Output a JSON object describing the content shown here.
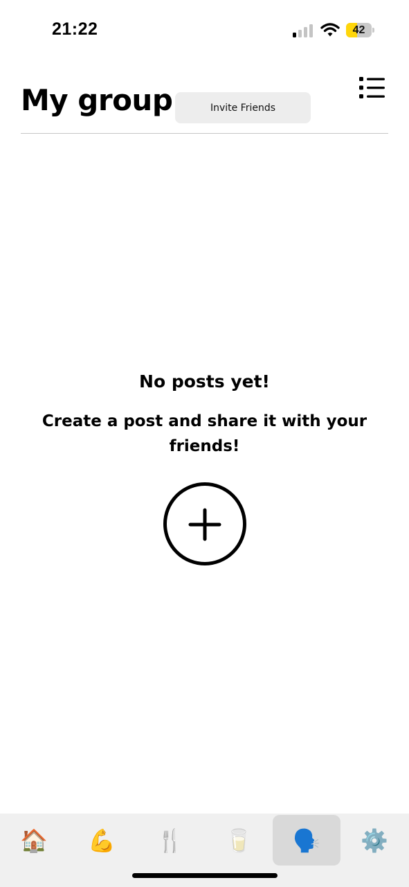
{
  "status_bar": {
    "time": "21:22",
    "battery_level": "42",
    "battery_fraction": 0.42,
    "signal_bars_active": 1,
    "signal_bars_total": 4,
    "icons": [
      "cellular-signal-icon",
      "wifi-icon",
      "battery-icon"
    ]
  },
  "header": {
    "title": "My group",
    "invite_label": "Invite Friends",
    "menu_icon": "list-menu-icon"
  },
  "empty_state": {
    "title": "No posts yet!",
    "subtitle": "Create a post and share it with your friends!",
    "add_icon": "plus-circle-icon"
  },
  "tab_bar": {
    "items": [
      {
        "name": "home",
        "glyph": "🏠",
        "icon": "house-icon",
        "active": false
      },
      {
        "name": "workout",
        "glyph": "💪",
        "icon": "flexed-biceps-icon",
        "active": false
      },
      {
        "name": "food",
        "glyph": "🍴",
        "icon": "fork-knife-icon",
        "active": false
      },
      {
        "name": "drink",
        "glyph": "🥛",
        "icon": "milk-glass-icon",
        "active": false
      },
      {
        "name": "group",
        "glyph": "🗣️",
        "icon": "speaking-head-icon",
        "active": true
      },
      {
        "name": "settings",
        "glyph": "⚙️",
        "icon": "gear-icon",
        "active": false
      }
    ]
  },
  "colors": {
    "background": "#ffffff",
    "button_bg": "#ededed",
    "tab_bar_bg": "#f0f0f0",
    "tab_active_bg": "#d9d9d9",
    "battery_fill": "#ffd60a",
    "text": "#000000"
  }
}
